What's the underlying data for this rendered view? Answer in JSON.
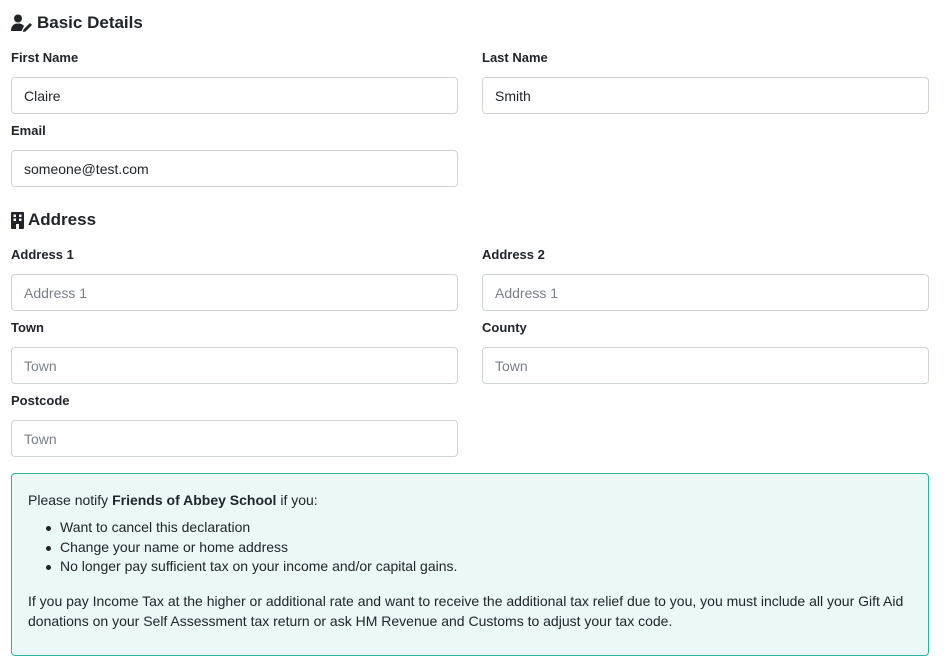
{
  "basic_details": {
    "title": "Basic Details",
    "icon": "user-edit-icon",
    "first_name": {
      "label": "First Name",
      "value": "Claire"
    },
    "last_name": {
      "label": "Last Name",
      "value": "Smith"
    },
    "email": {
      "label": "Email",
      "value": "someone@test.com"
    }
  },
  "address": {
    "title": "Address",
    "icon": "building-icon",
    "address1": {
      "label": "Address 1",
      "placeholder": "Address 1"
    },
    "address2": {
      "label": "Address 2",
      "placeholder": "Address 1"
    },
    "town": {
      "label": "Town",
      "placeholder": "Town"
    },
    "county": {
      "label": "County",
      "placeholder": "Town"
    },
    "postcode": {
      "label": "Postcode",
      "placeholder": "Town"
    }
  },
  "notice": {
    "intro_prefix": "Please notify ",
    "organisation": "Friends of Abbey School",
    "intro_suffix": " if you:",
    "items": [
      "Want to cancel this declaration",
      "Change your name or home address",
      "No longer pay sufficient tax on your income and/or capital gains."
    ],
    "footer": "If you pay Income Tax at the higher or additional rate and want to receive the additional tax relief due to you, you must include all your Gift Aid donations on your Self Assessment tax return or ask HM Revenue and Customs to adjust your tax code."
  },
  "colors": {
    "notice_background": "#ebf8f6",
    "notice_border": "#2fb3a1",
    "input_border": "#ced4da"
  }
}
